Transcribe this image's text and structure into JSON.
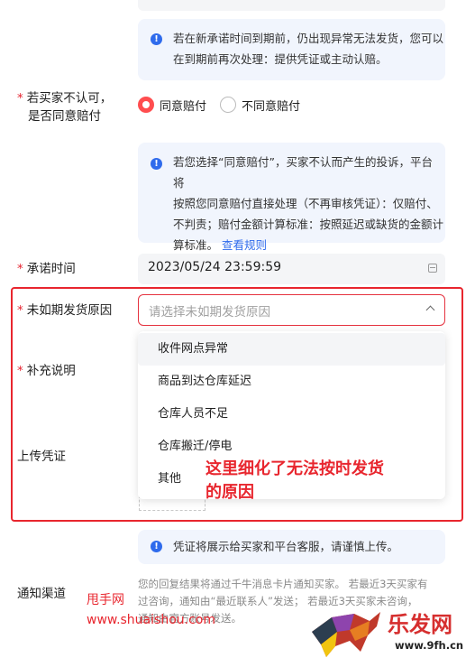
{
  "notice1": {
    "line1": "若在新承诺时间到期前，仍出现异常无法发货，您可以",
    "line2": "在到期前再次处理：提供凭证或主动认赔。"
  },
  "compensate": {
    "required_mark": "*",
    "label_line1": "若买家不认可，",
    "label_line2": "是否同意赔付",
    "option_agree": "同意赔付",
    "option_disagree": "不同意赔付"
  },
  "notice2": {
    "line1": "若您选择“同意赔付”，买家不认而产生的投诉，平台将",
    "line2": "按照您同意赔付直接处理（不再审核凭证）：仅赔付、",
    "line3": "不判责；赔付金额计算标准：按照延迟或缺货的金额计",
    "line4_text": "算标准。",
    "line4_link": "查看规则"
  },
  "promise_time": {
    "required_mark": "*",
    "label": "承诺时间",
    "value": "2023/05/24 23:59:59"
  },
  "reason": {
    "required_mark": "*",
    "label": "未如期发货原因",
    "placeholder": "请选择未如期发货原因",
    "options": [
      "收件网点异常",
      "商品到达仓库延迟",
      "仓库人员不足",
      "仓库搬迁/停电",
      "其他"
    ]
  },
  "supplement": {
    "required_mark": "*",
    "label": "补充说明"
  },
  "upload": {
    "label": "上传凭证"
  },
  "annotation": {
    "line1": "这里细化了无法按时发货",
    "line2": "的原因"
  },
  "notice3": {
    "text": "凭证将展示给买家和平台客服，请谨慎上传。"
  },
  "notify": {
    "label": "通知渠道",
    "line1": "您的回复结果将通过千牛消息卡片通知买家。 若最近3天买家有",
    "line2": "过咨询，通知由“最近联系人”发送； 若最近3天买家未咨询，",
    "line3": "通知由官方账号发送。"
  },
  "watermark": {
    "left_line1": "甩手网",
    "left_line2": "www.shuaishou.com",
    "right_brand": "乐发网",
    "right_url": "www.9fh.cn"
  },
  "colors": {
    "accent": "#2f6bec",
    "required": "#e5232f",
    "radio_selected": "#ff4d4f",
    "annotation_red": "#e8262e"
  }
}
